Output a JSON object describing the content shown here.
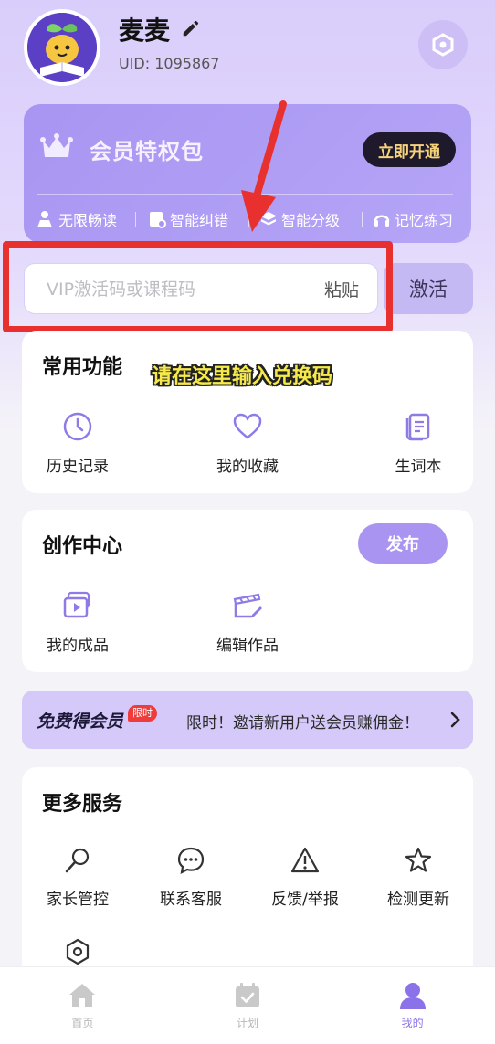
{
  "profile": {
    "username": "麦麦",
    "uid": "UID: 1095867"
  },
  "vip": {
    "title": "会员特权包",
    "open_button": "立即开通",
    "perks": [
      "无限畅读",
      "智能纠错",
      "智能分级",
      "记忆练习"
    ]
  },
  "activation": {
    "placeholder": "VIP激活码或课程码",
    "paste_label": "粘贴",
    "activate_label": "激活"
  },
  "annotation": {
    "text": "请在这里输入兑换码",
    "highlight_color": "#e8312f"
  },
  "common_functions": {
    "title": "常用功能",
    "items": [
      {
        "label": "历史记录",
        "icon": "clock-icon"
      },
      {
        "label": "我的收藏",
        "icon": "heart-icon"
      },
      {
        "label": "生词本",
        "icon": "notebook-icon"
      }
    ]
  },
  "creation_center": {
    "title": "创作中心",
    "publish_label": "发布",
    "items": [
      {
        "label": "我的成品",
        "icon": "video-stack-icon"
      },
      {
        "label": "编辑作品",
        "icon": "clapper-edit-icon"
      }
    ]
  },
  "promo": {
    "title": "免费得会员",
    "badge": "限时",
    "text": "限时！邀请新用户送会员赚佣金！"
  },
  "more_services": {
    "title": "更多服务",
    "items": [
      {
        "label": "家长管控",
        "icon": "magnifier-icon"
      },
      {
        "label": "联系客服",
        "icon": "chat-bubble-icon"
      },
      {
        "label": "反馈/举报",
        "icon": "warning-icon"
      },
      {
        "label": "检测更新",
        "icon": "star-icon"
      },
      {
        "label": "",
        "icon": "hexagon-icon"
      }
    ]
  },
  "tabbar": {
    "tabs": [
      {
        "label": "首页",
        "icon": "home-icon"
      },
      {
        "label": "计划",
        "icon": "calendar-check-icon"
      },
      {
        "label": "我的",
        "icon": "user-icon",
        "active": true
      }
    ]
  },
  "colors": {
    "accent": "#a995f1",
    "vip_card": "#b0a0f4",
    "active_tab": "#8b72e8"
  }
}
